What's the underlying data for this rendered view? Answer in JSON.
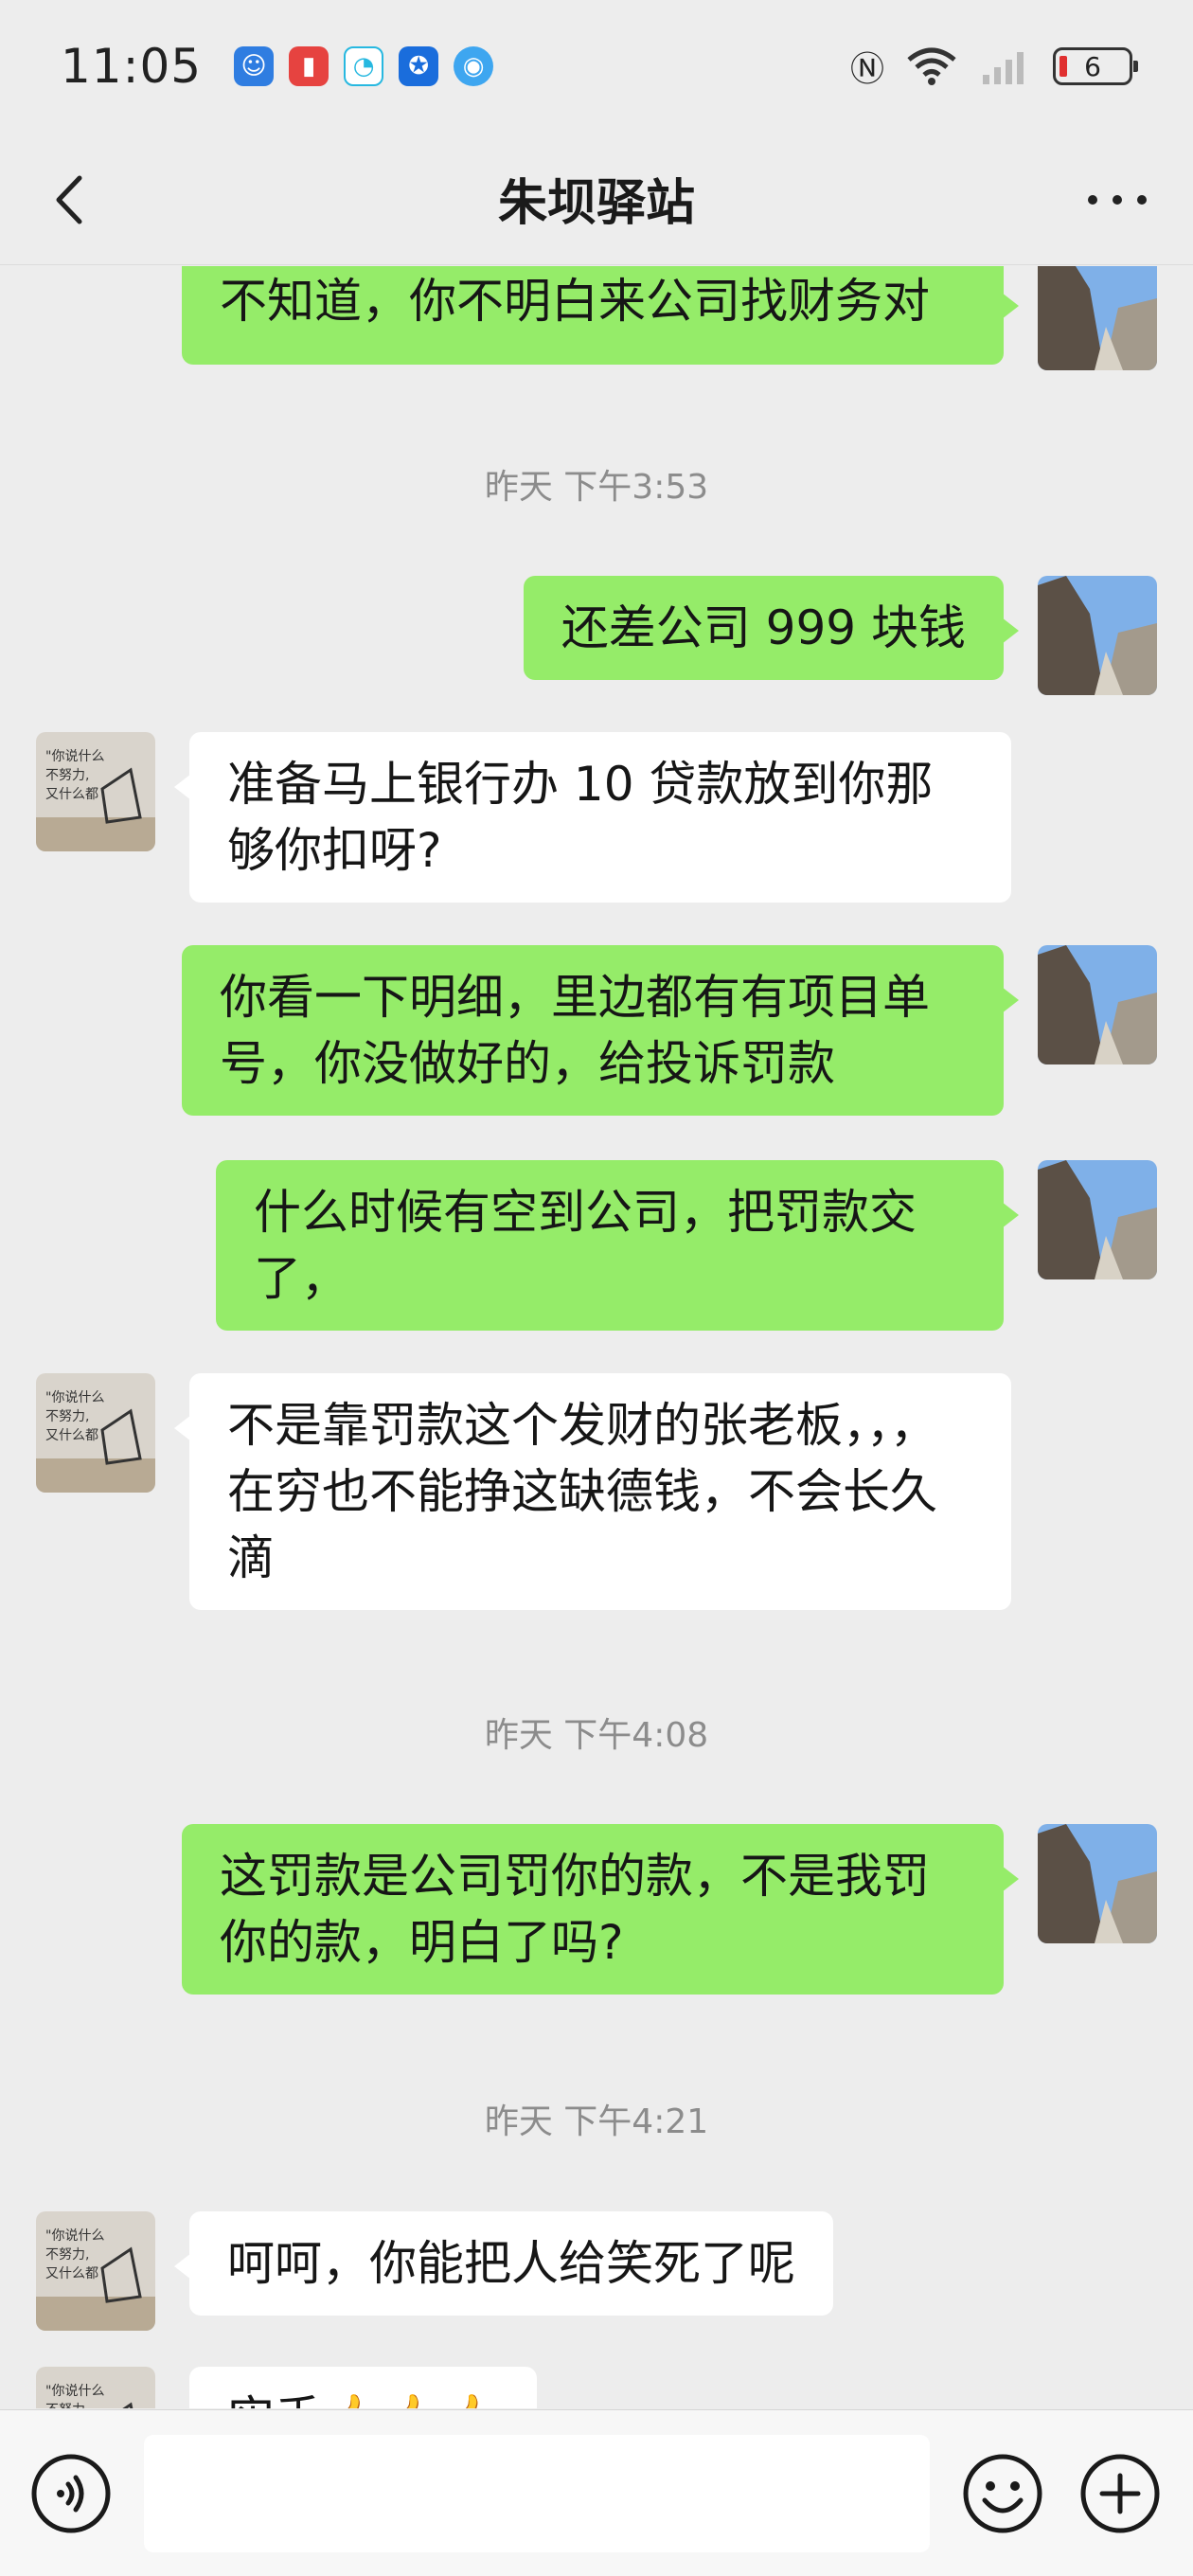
{
  "status_bar": {
    "time": "11:05",
    "battery": "6",
    "notif_icons": [
      {
        "name": "app-notification-blue-icon",
        "color": "#2f7de1"
      },
      {
        "name": "app-notification-red-icon",
        "color": "#e64340"
      },
      {
        "name": "chat-bubble-notification-icon",
        "color": "#27b8e0"
      },
      {
        "name": "lightbulb-notification-icon",
        "color": "#1a6ddc"
      },
      {
        "name": "globe-notification-icon",
        "color": "#3ea6f0"
      }
    ]
  },
  "header": {
    "title": "朱坝驿站"
  },
  "messages": [
    {
      "side": "right",
      "text": "不知道，你不明白来公司找财务对"
    },
    {
      "side": "right",
      "text": "还差公司 999 块钱"
    },
    {
      "side": "left",
      "text": "准备马上银行办 10 贷款放到你那够你扣呀?"
    },
    {
      "side": "right",
      "text": "你看一下明细，里边都有有项目单号，你没做好的，给投诉罚款"
    },
    {
      "side": "right",
      "text": "什么时候有空到公司，把罚款交了，"
    },
    {
      "side": "left",
      "text": "不是靠罚款这个发财的张老板，，，在穷也不能挣这缺德钱，不会长久滴"
    },
    {
      "side": "right",
      "text": "这罚款是公司罚你的款，不是我罚你的款，明白了吗?"
    },
    {
      "side": "left",
      "text": "呵呵，你能把人给笑死了呢"
    },
    {
      "side": "left",
      "text": "实手👍👍👍"
    }
  ],
  "timestamps": [
    "昨天 下午3:53",
    "昨天 下午4:08",
    "昨天 下午4:21"
  ],
  "input_bar": {
    "placeholder": ""
  },
  "colors": {
    "sent_bubble": "#95ec69",
    "received_bubble": "#ffffff",
    "background": "#ededed"
  }
}
